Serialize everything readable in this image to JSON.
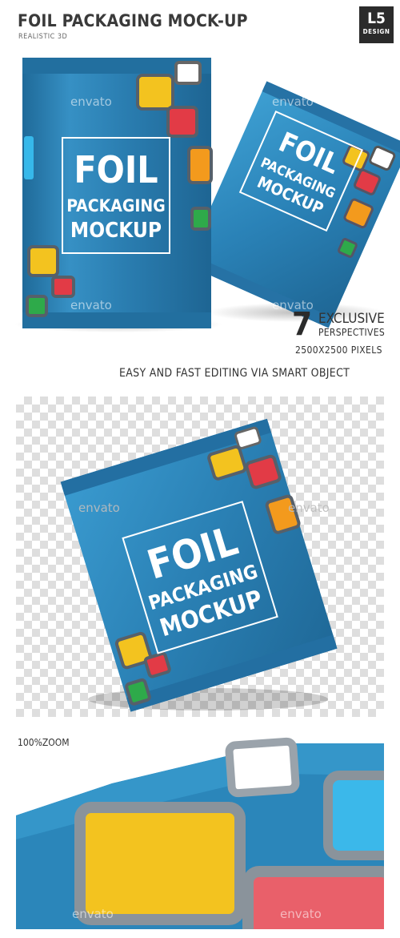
{
  "header": {
    "title": "FOIL PACKAGING MOCK-UP",
    "subtitle": "REALISTIC 3D",
    "logo_line1": "L5",
    "logo_line2": "DESIGN"
  },
  "package": {
    "line1": "FOIL",
    "line2": "PACKAGING",
    "line3": "MOCKUP"
  },
  "watermark": "envato",
  "features": {
    "count": "7",
    "line1": "EXCLUSIVE",
    "line2": "PERSPECTIVES",
    "resolution": "2500X2500 PIXELS",
    "editing": "EASY AND FAST EDITING VIA SMART OBJECT"
  },
  "zoom": {
    "label": "100%ZOOM"
  },
  "colors": {
    "foil_blue": "#2c7fb0",
    "yellow": "#f3c31f",
    "red": "#e23b46",
    "orange": "#f39a1d",
    "green": "#2eaa4a",
    "light_blue": "#36b8ea"
  }
}
